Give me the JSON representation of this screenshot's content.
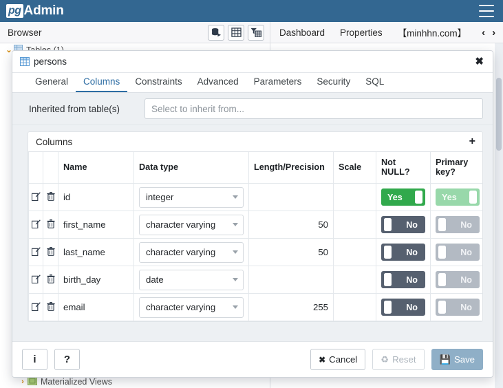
{
  "brand": {
    "pg": "pg",
    "admin": "Admin",
    "menu_icon": "hamburger-icon"
  },
  "toolbar": {
    "browser_label": "Browser",
    "icons": [
      {
        "name": "query-tool-icon",
        "title": "Query Tool"
      },
      {
        "name": "view-data-icon",
        "title": "View Data"
      },
      {
        "name": "filtered-rows-icon",
        "title": "Filtered Rows"
      }
    ],
    "nav": [
      {
        "label": "Dashboard",
        "name": "tab-dashboard"
      },
      {
        "label": "Properties",
        "name": "tab-properties"
      },
      {
        "label": "【minhhn.com】",
        "name": "tab-minhhn"
      }
    ],
    "prev_arrow": "‹",
    "next_arrow": "›"
  },
  "background_tree": [
    {
      "chevron": "⌄",
      "label": "Tables (1)",
      "icon": "tables-icon"
    },
    {
      "chevron": "›",
      "label": "Materialized Views",
      "icon": "materialized-views-icon"
    }
  ],
  "dialog": {
    "title": "persons",
    "title_icon": "table-icon",
    "close_label": "✖",
    "tabs": [
      {
        "label": "General",
        "active": false
      },
      {
        "label": "Columns",
        "active": true
      },
      {
        "label": "Constraints",
        "active": false
      },
      {
        "label": "Advanced",
        "active": false
      },
      {
        "label": "Parameters",
        "active": false
      },
      {
        "label": "Security",
        "active": false
      },
      {
        "label": "SQL",
        "active": false
      }
    ],
    "inherited": {
      "label": "Inherited from table(s)",
      "value": "",
      "placeholder": "Select to inherit from..."
    },
    "columns_panel": {
      "title": "Columns",
      "add_label": "+"
    },
    "grid": {
      "headers": [
        "",
        "",
        "Name",
        "Data type",
        "Length/Precision",
        "Scale",
        "Not NULL?",
        "Primary key?"
      ],
      "rows": [
        {
          "name": "id",
          "data_type": "integer",
          "length": "",
          "scale": "",
          "not_null": {
            "label": "Yes",
            "state": "on",
            "disabled": false
          },
          "primary_key": {
            "label": "Yes",
            "state": "on",
            "disabled": true
          }
        },
        {
          "name": "first_name",
          "data_type": "character varying",
          "length": "50",
          "scale": "",
          "not_null": {
            "label": "No",
            "state": "off",
            "disabled": false
          },
          "primary_key": {
            "label": "No",
            "state": "off",
            "disabled": true
          }
        },
        {
          "name": "last_name",
          "data_type": "character varying",
          "length": "50",
          "scale": "",
          "not_null": {
            "label": "No",
            "state": "off",
            "disabled": false
          },
          "primary_key": {
            "label": "No",
            "state": "off",
            "disabled": true
          }
        },
        {
          "name": "birth_day",
          "data_type": "date",
          "length": "",
          "scale": "",
          "not_null": {
            "label": "No",
            "state": "off",
            "disabled": false
          },
          "primary_key": {
            "label": "No",
            "state": "off",
            "disabled": true
          }
        },
        {
          "name": "email",
          "data_type": "character varying",
          "length": "255",
          "scale": "",
          "not_null": {
            "label": "No",
            "state": "off",
            "disabled": false
          },
          "primary_key": {
            "label": "No",
            "state": "off",
            "disabled": true
          }
        }
      ]
    },
    "footer": {
      "info_label": "i",
      "help_label": "?",
      "cancel_label": "Cancel",
      "reset_label": "Reset",
      "save_label": "Save"
    }
  },
  "colors": {
    "brand_blue": "#336791",
    "tab_active": "#2c6ca3",
    "toggle_on": "#31a94c",
    "toggle_on_disabled": "#98d8aa",
    "toggle_off": "#56606f",
    "toggle_off_disabled": "#b3bac3",
    "save_button": "#8fafc7",
    "panel_bg": "#edf0f3"
  }
}
